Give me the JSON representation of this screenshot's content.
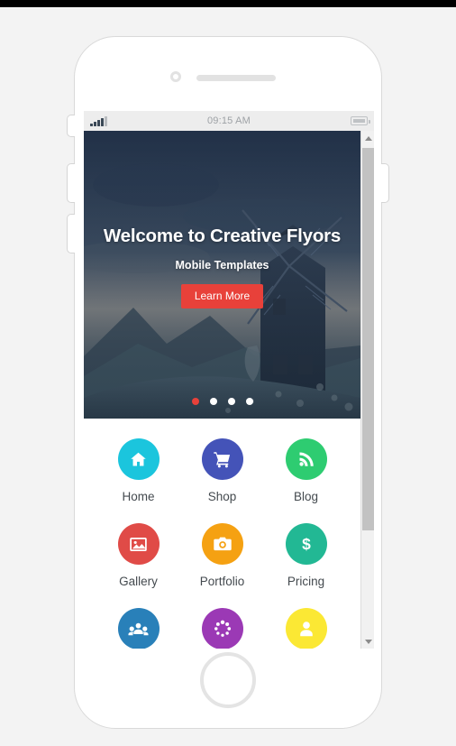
{
  "statusbar": {
    "time": "09:15 AM",
    "signal_icon": "signal-bars-icon",
    "battery_icon": "battery-icon"
  },
  "hero": {
    "title": "Welcome to Creative Flyors",
    "subtitle": "Mobile Templates",
    "cta_label": "Learn More",
    "cta_color": "#e8413a",
    "dots": [
      {
        "active": true,
        "color": "#e8413a"
      },
      {
        "active": false,
        "color": "#ffffff"
      },
      {
        "active": false,
        "color": "#ffffff"
      },
      {
        "active": false,
        "color": "#ffffff"
      }
    ],
    "image_description": "windmill on hillside at dusk"
  },
  "grid": {
    "items": [
      {
        "label": "Home",
        "icon": "house-icon",
        "color": "#1bc5dd"
      },
      {
        "label": "Shop",
        "icon": "cart-icon",
        "color": "#4453b8"
      },
      {
        "label": "Blog",
        "icon": "rss-icon",
        "color": "#2ecc71"
      },
      {
        "label": "Gallery",
        "icon": "image-icon",
        "color": "#e04b47"
      },
      {
        "label": "Portfolio",
        "icon": "camera-icon",
        "color": "#f5a112"
      },
      {
        "label": "Pricing",
        "icon": "dollar-icon",
        "color": "#22b894"
      },
      {
        "label": "",
        "icon": "users-group-icon",
        "color": "#2980b9"
      },
      {
        "label": "",
        "icon": "spinner-dots-icon",
        "color": "#9b39b5"
      },
      {
        "label": "",
        "icon": "user-icon",
        "color": "#fbe834"
      }
    ]
  },
  "scrollbar": {
    "up_icon": "scroll-up-arrow-icon",
    "down_icon": "scroll-down-arrow-icon"
  },
  "device": {
    "camera_icon": "front-camera-icon",
    "speaker_icon": "earpiece-speaker-icon",
    "home_button": "home-button"
  }
}
